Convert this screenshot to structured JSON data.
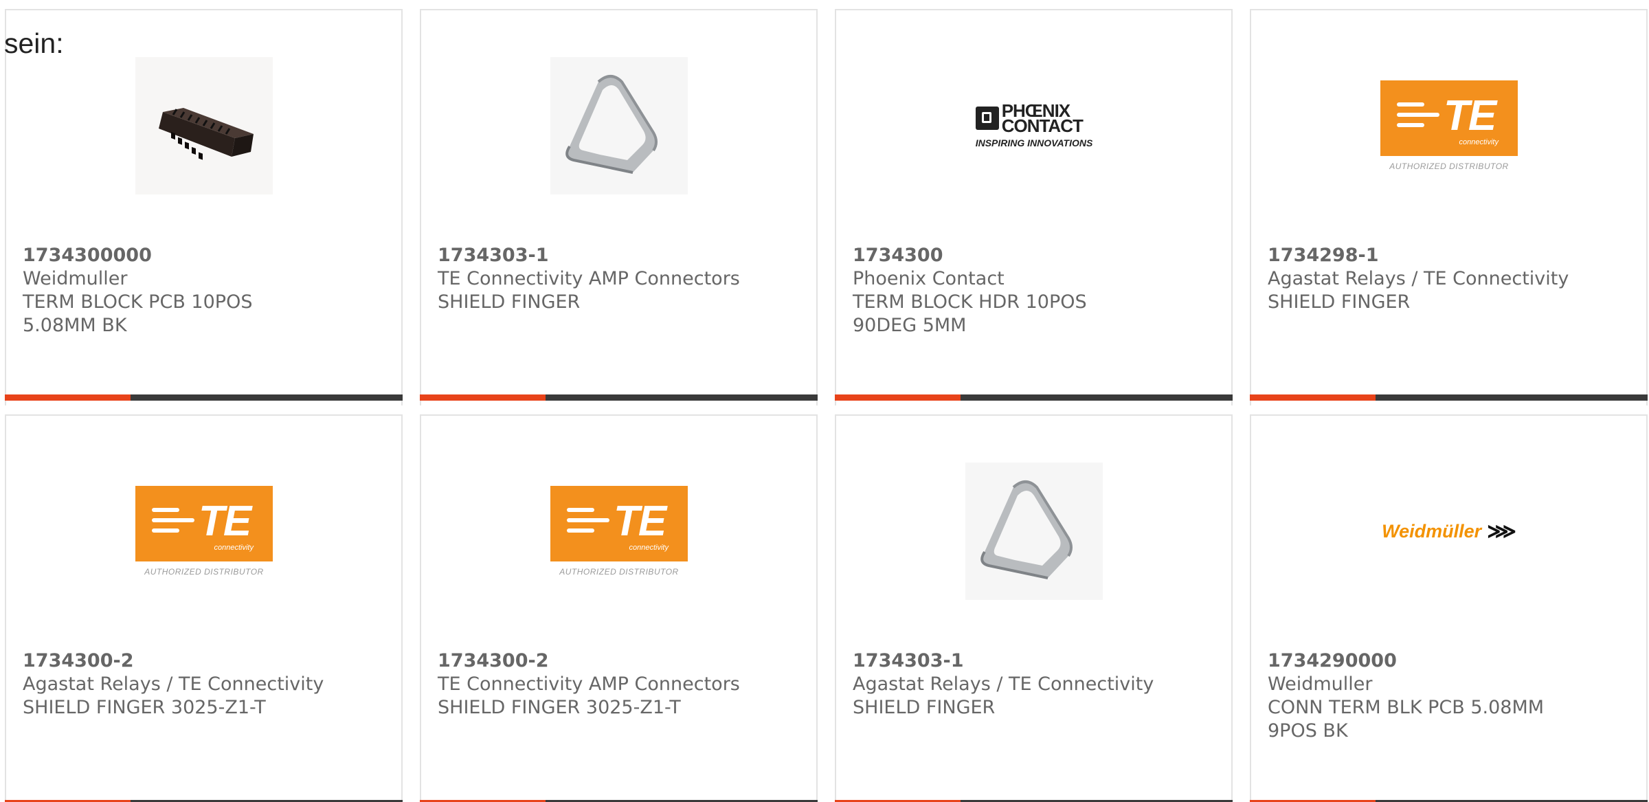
{
  "page_label": "sein:",
  "colors": {
    "accent": "#e8431a",
    "bar": "#3a3a3a",
    "text": "#666666",
    "te_orange": "#f3901d",
    "weidmuller_orange": "#f39200"
  },
  "cards": [
    {
      "part_number": "1734300000",
      "manufacturer": "Weidmuller",
      "description": "TERM BLOCK PCB 10POS 5.08MM BK",
      "image": "terminal-block-photo"
    },
    {
      "part_number": "1734303-1",
      "manufacturer": "TE Connectivity AMP Connectors",
      "description": "SHIELD FINGER",
      "image": "shield-finger-photo"
    },
    {
      "part_number": "1734300",
      "manufacturer": "Phoenix Contact",
      "description": "TERM BLOCK HDR 10POS 90DEG 5MM",
      "image": "phoenix-contact-logo"
    },
    {
      "part_number": "1734298-1",
      "manufacturer": "Agastat Relays / TE Connectivity",
      "description": "SHIELD FINGER",
      "image": "te-connectivity-logo"
    },
    {
      "part_number": "1734300-2",
      "manufacturer": "Agastat Relays / TE Connectivity",
      "description": "SHIELD FINGER 3025-Z1-T",
      "image": "te-connectivity-logo"
    },
    {
      "part_number": "1734300-2",
      "manufacturer": "TE Connectivity AMP Connectors",
      "description": "SHIELD FINGER 3025-Z1-T",
      "image": "te-connectivity-logo"
    },
    {
      "part_number": "1734303-1",
      "manufacturer": "Agastat Relays / TE Connectivity",
      "description": "SHIELD FINGER",
      "image": "shield-finger-photo"
    },
    {
      "part_number": "1734290000",
      "manufacturer": "Weidmuller",
      "description": "CONN TERM BLK PCB 5.08MM 9POS BK",
      "image": "weidmuller-logo"
    }
  ],
  "logos": {
    "te": {
      "brand": "TE",
      "subtitle": "connectivity",
      "tagline": "AUTHORIZED DISTRIBUTOR"
    },
    "phoenix": {
      "line1": "PHŒNIX",
      "line2": "CONTACT",
      "tagline": "INSPIRING INNOVATIONS"
    },
    "weidmuller": {
      "name": "Weidmüller",
      "mark": "⋙"
    }
  }
}
